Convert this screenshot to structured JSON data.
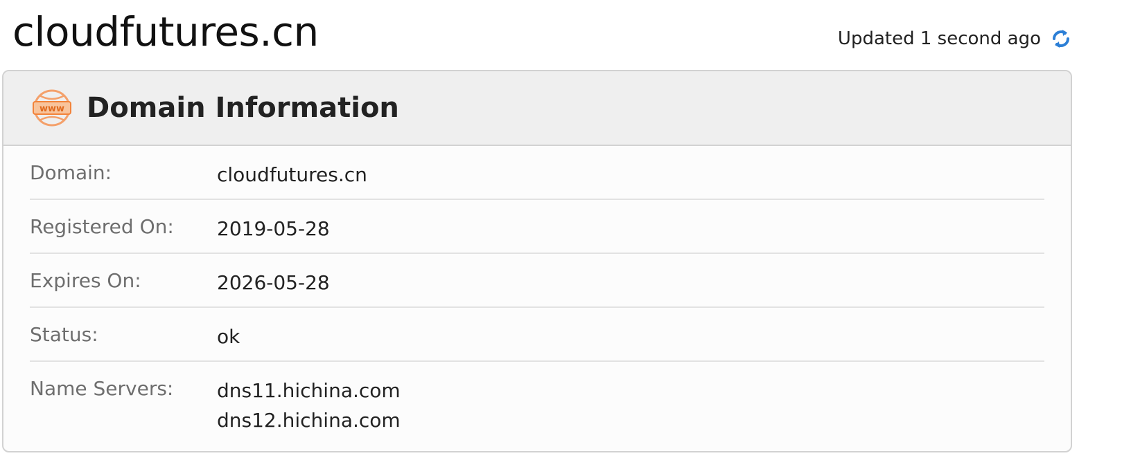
{
  "domain_title": "cloudfutures.cn",
  "updated": {
    "text": "Updated 1 second ago",
    "icon": "refresh-icon"
  },
  "card": {
    "title": "Domain Information",
    "icon": "www-globe-icon",
    "accent_color": "#f2833a",
    "refresh_color": "#2c7fd6"
  },
  "rows": [
    {
      "label": "Domain:",
      "value": "cloudfutures.cn"
    },
    {
      "label": "Registered On:",
      "value": "2019-05-28"
    },
    {
      "label": "Expires On:",
      "value": "2026-05-28"
    },
    {
      "label": "Status:",
      "value": "ok"
    },
    {
      "label": "Name Servers:",
      "values": [
        "dns11.hichina.com",
        "dns12.hichina.com"
      ]
    }
  ]
}
